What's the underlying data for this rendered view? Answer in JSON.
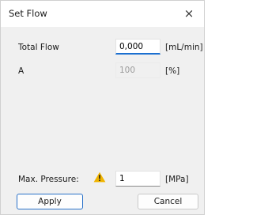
{
  "dialog": {
    "title": "Set Flow",
    "close_label": "×"
  },
  "fields": {
    "total_flow": {
      "label": "Total Flow",
      "value": "0,000",
      "unit": "[mL/min]"
    },
    "a": {
      "label": "A",
      "value": "100",
      "unit": "[%]"
    },
    "max_pressure": {
      "label": "Max. Pressure:",
      "value": "1",
      "unit": "[MPa]",
      "warning_icon": "warning-triangle-icon",
      "warning_color": "#f0b400"
    }
  },
  "buttons": {
    "apply": "Apply",
    "cancel": "Cancel"
  },
  "colors": {
    "focus_accent": "#1b6fd0",
    "default_button_border": "#2a72c9"
  }
}
